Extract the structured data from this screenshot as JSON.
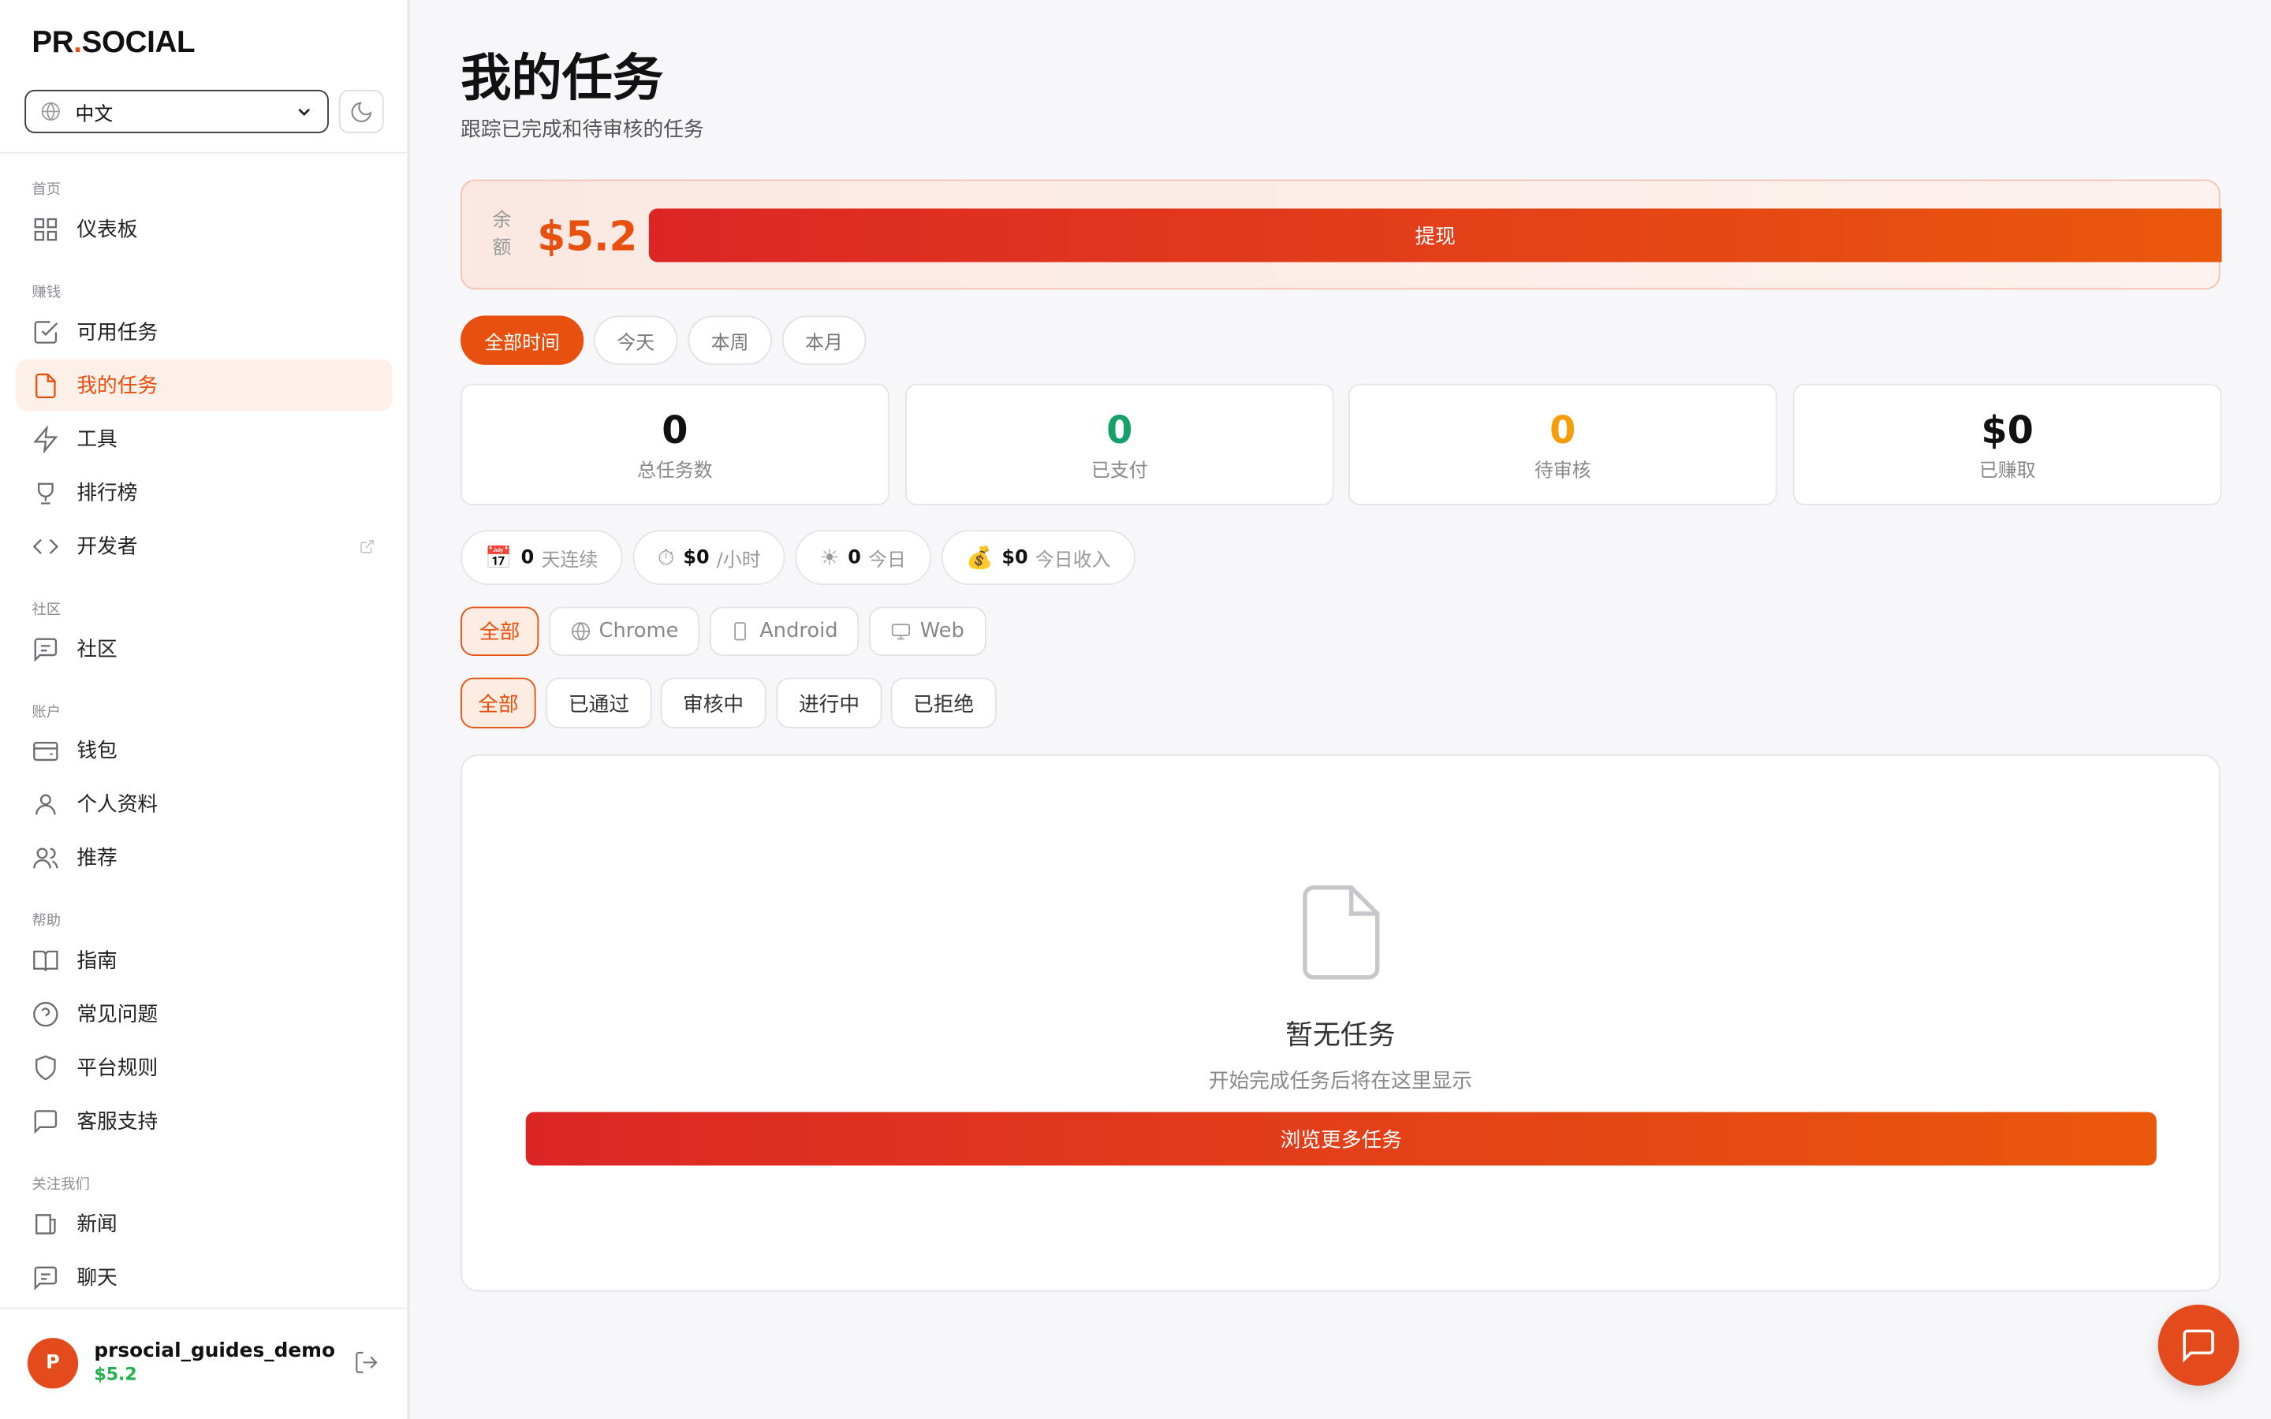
{
  "brand": {
    "left": "PR",
    "dot": ".",
    "right": "SOCIAL"
  },
  "lang": {
    "selected": "中文"
  },
  "sidebar": {
    "sections": [
      "首页",
      "赚钱",
      "社区",
      "账户",
      "帮助",
      "关注我们"
    ],
    "items": [
      {
        "label": "仪表板",
        "icon": "grid-icon"
      },
      {
        "label": "可用任务",
        "icon": "check-square-icon"
      },
      {
        "label": "我的任务",
        "icon": "file-icon",
        "active": true
      },
      {
        "label": "工具",
        "icon": "bolt-icon"
      },
      {
        "label": "排行榜",
        "icon": "trophy-icon"
      },
      {
        "label": "开发者",
        "icon": "code-icon"
      },
      {
        "label": "社区",
        "icon": "message-square-icon"
      },
      {
        "label": "钱包",
        "icon": "wallet-icon"
      },
      {
        "label": "个人资料",
        "icon": "user-icon"
      },
      {
        "label": "推荐",
        "icon": "users-icon"
      },
      {
        "label": "指南",
        "icon": "book-icon"
      },
      {
        "label": "常见问题",
        "icon": "help-circle-icon"
      },
      {
        "label": "平台规则",
        "icon": "shield-icon"
      },
      {
        "label": "客服支持",
        "icon": "message-icon"
      },
      {
        "label": "新闻",
        "icon": "newspaper-icon"
      },
      {
        "label": "聊天",
        "icon": "chat-icon"
      }
    ]
  },
  "user": {
    "initial": "P",
    "name": "prsocial_guides_demo",
    "balance": "$5.2"
  },
  "page": {
    "title": "我的任务",
    "subtitle": "跟踪已完成和待审核的任务"
  },
  "balance": {
    "label": "余额",
    "amount": "$5.2",
    "withdraw": "提现"
  },
  "time_filters": [
    "全部时间",
    "今天",
    "本周",
    "本月"
  ],
  "stats": [
    {
      "value": "0",
      "label": "总任务数",
      "color": "#111111"
    },
    {
      "value": "0",
      "label": "已支付",
      "color": "#16a06a"
    },
    {
      "value": "0",
      "label": "待审核",
      "color": "#f59e0b"
    },
    {
      "value": "$0",
      "label": "已赚取",
      "color": "#111111"
    }
  ],
  "chips": [
    {
      "icon": "📅",
      "value": "0",
      "label": "天连续"
    },
    {
      "icon": "⏱",
      "value": "$0",
      "label": "/小时"
    },
    {
      "icon": "☀",
      "value": "0",
      "label": "今日"
    },
    {
      "icon": "💰",
      "value": "$0",
      "label": "今日收入"
    }
  ],
  "platform_filters": [
    "全部",
    "Chrome",
    "Android",
    "Web"
  ],
  "status_filters": [
    "全部",
    "已通过",
    "审核中",
    "进行中",
    "已拒绝"
  ],
  "empty": {
    "title": "暂无任务",
    "desc": "开始完成任务后将在这里显示",
    "button": "浏览更多任务"
  },
  "accent": "#e8500f"
}
